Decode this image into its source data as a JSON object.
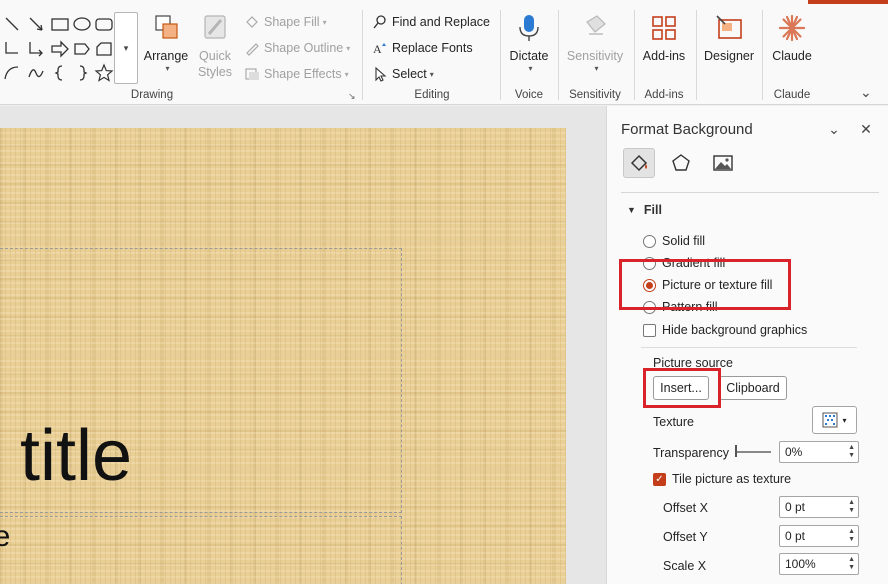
{
  "ribbon": {
    "groups": {
      "drawing": "Drawing",
      "editing": "Editing",
      "voice": "Voice",
      "sensitivity": "Sensitivity",
      "addins": "Add-ins",
      "claude": "Claude"
    },
    "arrange": "Arrange",
    "quick_styles": "Quick Styles",
    "shape_fill": "Shape Fill",
    "shape_outline": "Shape Outline",
    "shape_effects": "Shape Effects",
    "find_replace": "Find and Replace",
    "replace_fonts": "Replace Fonts",
    "select": "Select",
    "dictate": "Dictate",
    "sensitivity": "Sensitivity",
    "addins": "Add-ins",
    "designer": "Designer",
    "claude": "Claude"
  },
  "slide": {
    "title_text": "d title",
    "subtitle_text": "itle"
  },
  "pane": {
    "title": "Format Background",
    "section": "Fill",
    "fill_options": {
      "solid": "Solid fill",
      "gradient": "Gradient fill",
      "picture": "Picture or texture fill",
      "pattern": "Pattern fill"
    },
    "hide_bg": "Hide background graphics",
    "picture_source": "Picture source",
    "insert": "Insert...",
    "clipboard": "Clipboard",
    "texture": "Texture",
    "transparency": "Transparency",
    "transparency_value": "0%",
    "tile": "Tile picture as texture",
    "offset_x": "Offset X",
    "offset_x_value": "0 pt",
    "offset_y": "Offset Y",
    "offset_y_value": "0 pt",
    "scale_x": "Scale X",
    "scale_x_value": "100%"
  },
  "colors": {
    "accent": "#c43e1c",
    "highlight": "#d8232a",
    "slide_texture": "#e9cf95"
  }
}
